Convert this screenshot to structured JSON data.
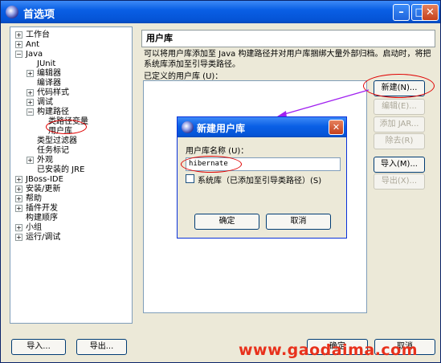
{
  "window": {
    "title": "首选项"
  },
  "tree": {
    "items": [
      {
        "label": "工作台",
        "expander": "+"
      },
      {
        "label": "Ant",
        "expander": "+"
      },
      {
        "label": "Java",
        "expander": "−"
      },
      {
        "label": "JUnit",
        "expander": ""
      },
      {
        "label": "编辑器",
        "expander": "+"
      },
      {
        "label": "编译器",
        "expander": ""
      },
      {
        "label": "代码样式",
        "expander": "+"
      },
      {
        "label": "调试",
        "expander": "+"
      },
      {
        "label": "构建路径",
        "expander": "−"
      },
      {
        "label": "类路径变量",
        "expander": ""
      },
      {
        "label": "用户库",
        "expander": ""
      },
      {
        "label": "类型过滤器",
        "expander": ""
      },
      {
        "label": "任务标记",
        "expander": ""
      },
      {
        "label": "外观",
        "expander": "+"
      },
      {
        "label": "已安装的 JRE",
        "expander": ""
      },
      {
        "label": "JBoss-IDE",
        "expander": "+"
      },
      {
        "label": "安装/更新",
        "expander": "+"
      },
      {
        "label": "帮助",
        "expander": "+"
      },
      {
        "label": "插件开发",
        "expander": "+"
      },
      {
        "label": "构建顺序",
        "expander": ""
      },
      {
        "label": "小组",
        "expander": "+"
      },
      {
        "label": "运行/调试",
        "expander": "+"
      }
    ]
  },
  "page": {
    "header": "用户库",
    "description": "可以将用户库添加至 Java 构建路径并对用户库捆绑大量外部归档。启动时，将把系统库添加至引导类路径。",
    "libraries_label": "已定义的用户库 (U)："
  },
  "side_buttons": {
    "new": "新建(N)...",
    "edit": "编辑(E)...",
    "add_jar": "添加 JAR...",
    "remove": "除去(R)",
    "import": "导入(M)...",
    "export": "导出(X)..."
  },
  "bottom_buttons": {
    "import": "导入...",
    "export": "导出...",
    "ok": "确定",
    "cancel": "取消"
  },
  "dialog": {
    "title": "新建用户库",
    "name_label": "用户库名称 (U)：",
    "name_value": "hibernate",
    "system_lib_label": "系统库（已添加至引导类路径）(S)",
    "ok": "确定",
    "cancel": "取消"
  },
  "watermark": "www.gaodaima.com",
  "colors": {
    "annotation": "#e00000",
    "arrow": "#a020f0",
    "titlebar": "#0a5fe5",
    "watermark": "#e8311c"
  }
}
